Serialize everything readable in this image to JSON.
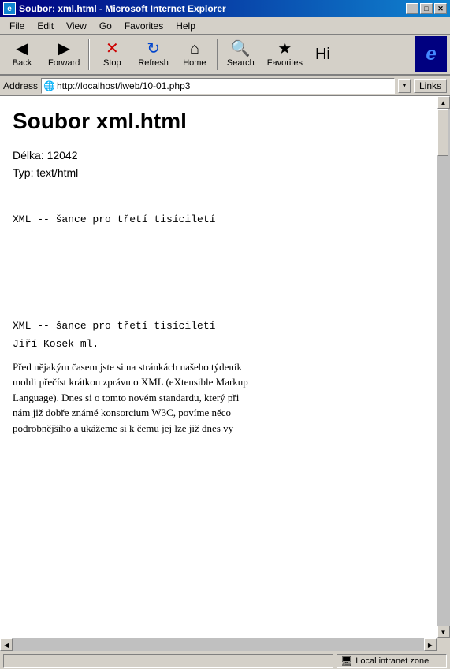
{
  "titleBar": {
    "title": "Soubor: xml.html - Microsoft Internet Explorer",
    "minBtn": "–",
    "maxBtn": "□",
    "closeBtn": "✕"
  },
  "menuBar": {
    "items": [
      {
        "label": "File"
      },
      {
        "label": "Edit"
      },
      {
        "label": "View"
      },
      {
        "label": "Go"
      },
      {
        "label": "Favorites"
      },
      {
        "label": "Help"
      }
    ]
  },
  "toolbar": {
    "buttons": [
      {
        "label": "Back",
        "icon": "◀"
      },
      {
        "label": "Forward",
        "icon": "▶"
      },
      {
        "label": "Stop",
        "icon": "✕"
      },
      {
        "label": "Refresh",
        "icon": "↻"
      },
      {
        "label": "Home",
        "icon": "⌂"
      },
      {
        "label": "Search",
        "icon": "🔍"
      },
      {
        "label": "Favorites",
        "icon": "★"
      },
      {
        "label": "Hi",
        "icon": ""
      }
    ]
  },
  "addressBar": {
    "label": "Address",
    "url": "http://localhost/iweb/10-01.php3",
    "linksLabel": "Links"
  },
  "page": {
    "title": "Soubor xml.html",
    "delkaLabel": "Délka:",
    "delkaValue": "12042",
    "typLabel": "Typ:",
    "typValue": "text/html",
    "xmlLine1": "XML -- šance pro třetí tisíciletí",
    "xmlLine2": "XML -- šance pro třetí tisíciletí",
    "author": "Jiří Kosek ml.",
    "bodyText": "Před nějakým časem jste si na stránkách našeho týdeník\nmohli přečíst krátkou zprávu o XML (eXtensible Markup\nLanguage). Dnes si o tomto novém standardu, který při\nnám již dobře známé konsorcium W3C, povíme něco\npodrobnějšího a ukážeme si k čemu jej lze již dnes vy"
  },
  "statusBar": {
    "main": "",
    "zone": "Local intranet zone"
  }
}
